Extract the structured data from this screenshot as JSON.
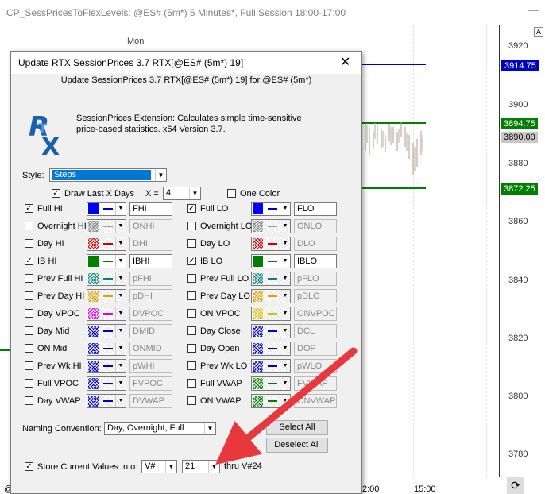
{
  "chart": {
    "title": "CP_SessPricesToFlexLevels: @ES# (5m*) 5 Minutes*, Full Session 18:00-17:00",
    "minimize": "—",
    "day_label": "Mon",
    "axis_badge": "A",
    "ticks": [
      "3920",
      "3900",
      "3880",
      "3860",
      "3840",
      "3820",
      "3800",
      "3780"
    ],
    "price_tags": [
      "3914.75",
      "3894.75",
      "3890.00",
      "3872.25"
    ],
    "time_labels": [
      "2:00",
      "15:00"
    ],
    "bottom_left": "@"
  },
  "dialog": {
    "title": "Update RTX SessionPrices 3.7 RTX[@ES# (5m*) 19]",
    "close": "✕",
    "subtitle": "Update SessionPrices 3.7 RTX[@ES# (5m*) 19] for @ES# (5m*)",
    "description": "SessionPrices Extension: Calculates simple time-sensitive price-based statistics. x64 Version 3.7.",
    "logo_text": "RTX",
    "style_label": "Style:",
    "style_value": "Steps",
    "draw_last_label": "Draw Last X Days",
    "x_label": "X =",
    "x_value": "4",
    "one_color_label": "One Color",
    "rows": [
      {
        "left": {
          "label": "Full HI",
          "checked": true,
          "color": "#0000ff",
          "line": "#0000c0",
          "text": "FHI",
          "enabled": true
        },
        "right": {
          "label": "Full LO",
          "checked": true,
          "color": "#0000ff",
          "line": "#0000c0",
          "text": "FLO",
          "enabled": true
        }
      },
      {
        "left": {
          "label": "Overnight HI",
          "checked": false,
          "color": "#808080",
          "line": "#999999",
          "text": "ONHI",
          "enabled": false
        },
        "right": {
          "label": "Overnight LO",
          "checked": false,
          "color": "#808080",
          "line": "#999999",
          "text": "ONLO",
          "enabled": false
        }
      },
      {
        "left": {
          "label": "Day HI",
          "checked": false,
          "color": "#d00000",
          "line": "#d00000",
          "text": "DHI",
          "enabled": false
        },
        "right": {
          "label": "Day LO",
          "checked": false,
          "color": "#d00000",
          "line": "#d00000",
          "text": "DLO",
          "enabled": false
        }
      },
      {
        "left": {
          "label": "IB HI",
          "checked": true,
          "color": "#008000",
          "line": "#008000",
          "text": "IBHI",
          "enabled": true
        },
        "right": {
          "label": "IB LO",
          "checked": true,
          "color": "#008000",
          "line": "#008000",
          "text": "IBLO",
          "enabled": true
        }
      },
      {
        "left": {
          "label": "Prev Full HI",
          "checked": false,
          "color": "#008080",
          "line": "#008080",
          "text": "pFHI",
          "enabled": false
        },
        "right": {
          "label": "Prev Full LO",
          "checked": false,
          "color": "#008080",
          "line": "#008080",
          "text": "pFLO",
          "enabled": false
        }
      },
      {
        "left": {
          "label": "Prev Day HI",
          "checked": false,
          "color": "#e0a000",
          "line": "#e0a000",
          "text": "pDHI",
          "enabled": false
        },
        "right": {
          "label": "Prev Day LO",
          "checked": false,
          "color": "#e0a000",
          "line": "#e0a000",
          "text": "pDLO",
          "enabled": false
        }
      },
      {
        "left": {
          "label": "Day VPOC",
          "checked": false,
          "color": "#e000e0",
          "line": "#e000e0",
          "text": "DVPOC",
          "enabled": false
        },
        "right": {
          "label": "ON VPOC",
          "checked": false,
          "color": "#e0c000",
          "line": "#e0c000",
          "text": "ONVPOC",
          "enabled": false
        }
      },
      {
        "left": {
          "label": "Day Mid",
          "checked": false,
          "color": "#0000c0",
          "line": "#0000c0",
          "text": "DMID",
          "enabled": false
        },
        "right": {
          "label": "Day Close",
          "checked": false,
          "color": "#0000c0",
          "line": "#0000c0",
          "text": "DCL",
          "enabled": false
        }
      },
      {
        "left": {
          "label": "ON Mid",
          "checked": false,
          "color": "#0000c0",
          "line": "#0000c0",
          "text": "ONMID",
          "enabled": false
        },
        "right": {
          "label": "Day Open",
          "checked": false,
          "color": "#0000c0",
          "line": "#0000c0",
          "text": "DOP",
          "enabled": false
        }
      },
      {
        "left": {
          "label": "Prev Wk HI",
          "checked": false,
          "color": "#0000c0",
          "line": "#0000c0",
          "text": "pWHI",
          "enabled": false
        },
        "right": {
          "label": "Prev Wk LO",
          "checked": false,
          "color": "#0000c0",
          "line": "#0000c0",
          "text": "pWLO",
          "enabled": false
        }
      },
      {
        "left": {
          "label": "Full VPOC",
          "checked": false,
          "color": "#0000c0",
          "line": "#0000c0",
          "text": "FVPOC",
          "enabled": false
        },
        "right": {
          "label": "Full VWAP",
          "checked": false,
          "color": "#008000",
          "line": "#008000",
          "text": "FVWAP",
          "enabled": false
        }
      },
      {
        "left": {
          "label": "Day VWAP",
          "checked": false,
          "color": "#0000c0",
          "line": "#0000c0",
          "text": "DVWAP",
          "enabled": false
        },
        "right": {
          "label": "ON VWAP",
          "checked": false,
          "color": "#008000",
          "line": "#008000",
          "text": "ONVWAP",
          "enabled": false
        }
      }
    ],
    "naming_label": "Naming Convention:",
    "naming_value": "Day, Overnight, Full",
    "select_all": "Select All",
    "deselect_all": "Deselect All",
    "store_label": "Store Current Values Into:",
    "store_var": "V#",
    "store_num": "21",
    "thru_label": "thru V#24"
  },
  "colors": {
    "annotation_arrow": "#e8383d",
    "selection": "#0078d7"
  }
}
